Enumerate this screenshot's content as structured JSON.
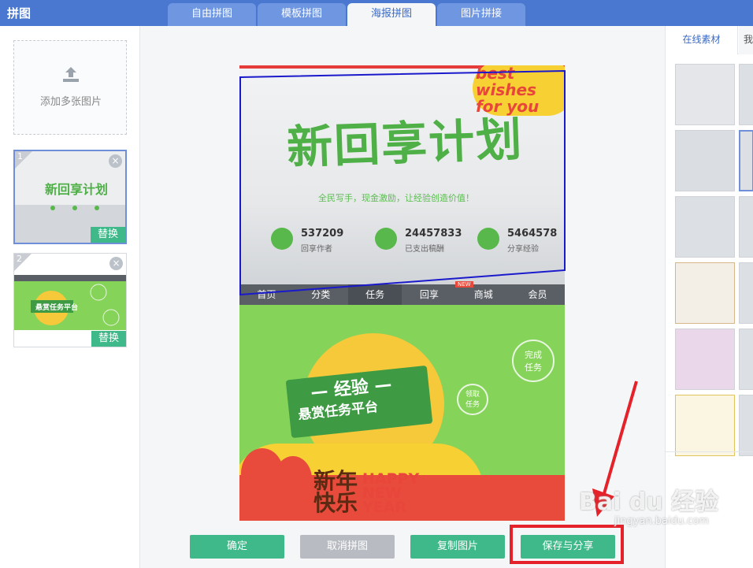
{
  "app": {
    "title": "拼图"
  },
  "tabs": [
    {
      "label": "自由拼图"
    },
    {
      "label": "模板拼图"
    },
    {
      "label": "海报拼图"
    },
    {
      "label": "图片拼接"
    }
  ],
  "left_panel": {
    "add_label": "添加多张图片",
    "images": [
      {
        "index": "1",
        "replace_label": "替换",
        "selected": true
      },
      {
        "index": "2",
        "replace_label": "替换",
        "selected": false
      }
    ]
  },
  "poster": {
    "top": {
      "headline": "新回享计划",
      "subline": "全民写手，现金激励，让经验创造价值！",
      "wishes": "best\nwishes\nfor you",
      "stats": [
        {
          "value": "537209",
          "caption": "回享作者"
        },
        {
          "value": "24457833",
          "caption": "已支出稿酬"
        },
        {
          "value": "5464578",
          "caption": "分享经验"
        }
      ]
    },
    "nav": [
      "首页",
      "分类",
      "任务",
      "回享",
      "商城",
      "会员"
    ],
    "nav_new_badge": "NEW",
    "bottom": {
      "banner_title": "— 经验 —",
      "banner_sub": "悬赏任务平台",
      "step1": "完成\n任务",
      "step2": "领取\n任务",
      "newyear_cn": "新年\n快乐",
      "newyear_en": "HAPPY\nNEW\nYEAR"
    }
  },
  "buttons": {
    "confirm": "确定",
    "cancel": "取消拼图",
    "copy": "复制图片",
    "save_share": "保存与分享"
  },
  "right_panel": {
    "tab_online": "在线素材",
    "tab_second": "我"
  },
  "watermark": {
    "main": "Bai du 经验",
    "sub": "jingyan.baidu.com"
  },
  "colors": {
    "topbar": "#4a78d0",
    "accent_green": "#3fb98a",
    "highlight_red": "#e5212a"
  }
}
